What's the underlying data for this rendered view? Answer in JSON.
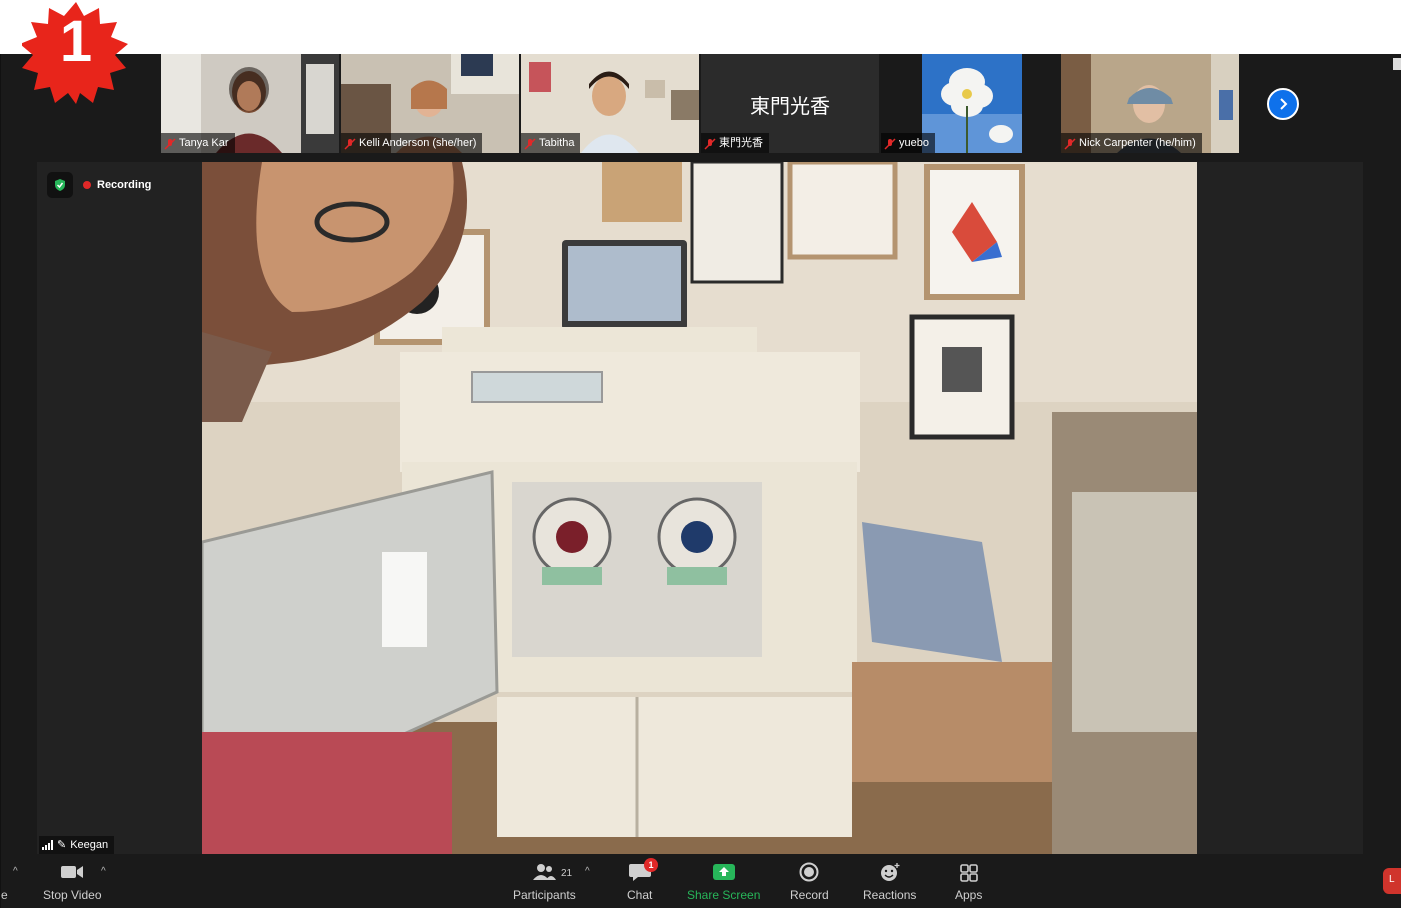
{
  "step_badge": {
    "number": "1",
    "color": "#e8251b"
  },
  "participant_strip": [
    {
      "name": "Tanya Kar",
      "muted": true
    },
    {
      "name": "Kelli Anderson (she/her)",
      "muted": true
    },
    {
      "name": "Tabitha",
      "muted": true
    },
    {
      "name": "東門光香",
      "muted": true,
      "video_off": true,
      "display_text": "東門光香"
    },
    {
      "name": "yuebo",
      "muted": true
    },
    {
      "name": "Nick Carpenter (he/him)",
      "muted": true
    }
  ],
  "strip_next_icon": "chevron-right-icon",
  "recording": {
    "label": "Recording",
    "icon": "shield-check-icon"
  },
  "active_speaker": {
    "name": "Keegan",
    "icons": [
      "signal-bars-icon",
      "pin-icon"
    ]
  },
  "toolbar": {
    "left_caret": "^",
    "stop_video": "Stop Video",
    "participants": "Participants",
    "participants_count": "21",
    "chat": "Chat",
    "chat_badge": "1",
    "share_screen": "Share Screen",
    "record": "Record",
    "reactions": "Reactions",
    "apps": "Apps",
    "edge_letter": "e",
    "leave_letter": "L"
  },
  "colors": {
    "accent_blue": "#0e71eb",
    "share_green": "#27b65a",
    "recording_red": "#e02828",
    "background": "#1a1a1a"
  }
}
